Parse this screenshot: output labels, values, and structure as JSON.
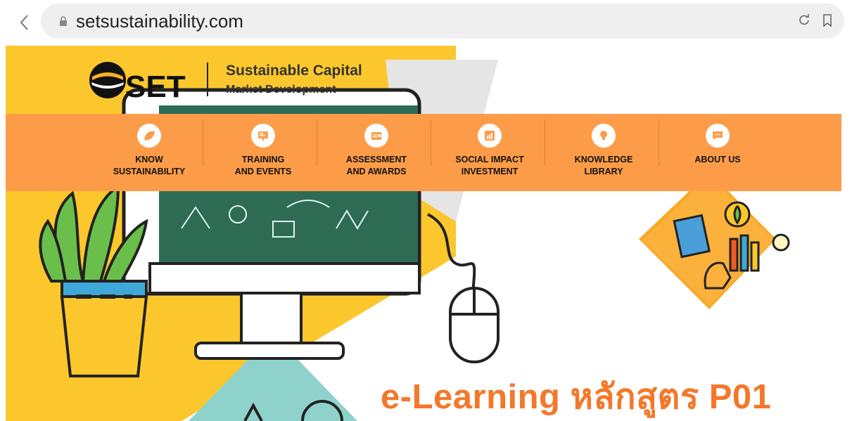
{
  "browser": {
    "url": "setsustainability.com"
  },
  "brand": {
    "logo_text": "SET",
    "line1": "Sustainable Capital",
    "line2": "Market Development"
  },
  "nav": {
    "items": [
      {
        "label": "KNOW\nSUSTAINABILITY",
        "icon": "leaf-icon"
      },
      {
        "label": "TRAINING\nAND EVENTS",
        "icon": "presentation-board-icon"
      },
      {
        "label": "ASSESSMENT\nAND AWARDS",
        "icon": "certificate-icon"
      },
      {
        "label": "SOCIAL IMPACT\nINVESTMENT",
        "icon": "bar-chart-icon"
      },
      {
        "label": "KNOWLEDGE\nLIBRARY",
        "icon": "lightbulb-icon"
      },
      {
        "label": "ABOUT US",
        "icon": "chat-bubble-icon"
      }
    ]
  },
  "hero": {
    "headline": "e-Learning หลักสูตร P01"
  },
  "colors": {
    "nav_orange": "#fd9c48",
    "accent_yellow": "#fcc72d",
    "accent_orange": "#f4782a",
    "screen_green": "#2d6b55"
  }
}
